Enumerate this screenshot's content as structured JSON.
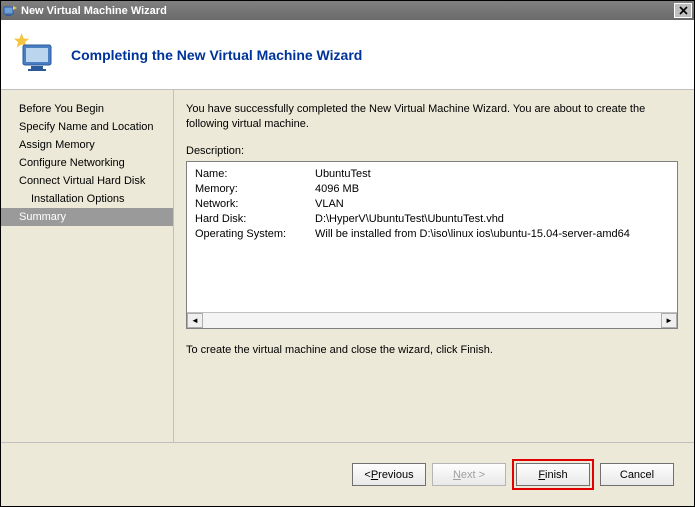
{
  "window": {
    "title": "New Virtual Machine Wizard"
  },
  "header": {
    "title": "Completing the New Virtual Machine Wizard"
  },
  "sidebar": {
    "items": [
      {
        "label": "Before You Begin",
        "indent": false,
        "selected": false
      },
      {
        "label": "Specify Name and Location",
        "indent": false,
        "selected": false
      },
      {
        "label": "Assign Memory",
        "indent": false,
        "selected": false
      },
      {
        "label": "Configure Networking",
        "indent": false,
        "selected": false
      },
      {
        "label": "Connect Virtual Hard Disk",
        "indent": false,
        "selected": false
      },
      {
        "label": "Installation Options",
        "indent": true,
        "selected": false
      },
      {
        "label": "Summary",
        "indent": false,
        "selected": true
      }
    ]
  },
  "content": {
    "intro": "You have successfully completed the New Virtual Machine Wizard. You are about to create the following virtual machine.",
    "description_label": "Description:",
    "rows": [
      {
        "k": "Name:",
        "v": "UbuntuTest"
      },
      {
        "k": "Memory:",
        "v": "4096 MB"
      },
      {
        "k": "Network:",
        "v": "VLAN"
      },
      {
        "k": "Hard Disk:",
        "v": "D:\\HyperV\\UbuntuTest\\UbuntuTest.vhd"
      },
      {
        "k": "Operating System:",
        "v": "Will be installed from D:\\iso\\linux ios\\ubuntu-15.04-server-amd64"
      }
    ],
    "outro": "To create the virtual machine and close the wizard, click Finish."
  },
  "buttons": {
    "previous_u": "P",
    "previous_text": "revious",
    "next_u": "N",
    "next_text": "ext >",
    "finish_u": "F",
    "finish_text": "inish",
    "cancel": "Cancel"
  }
}
